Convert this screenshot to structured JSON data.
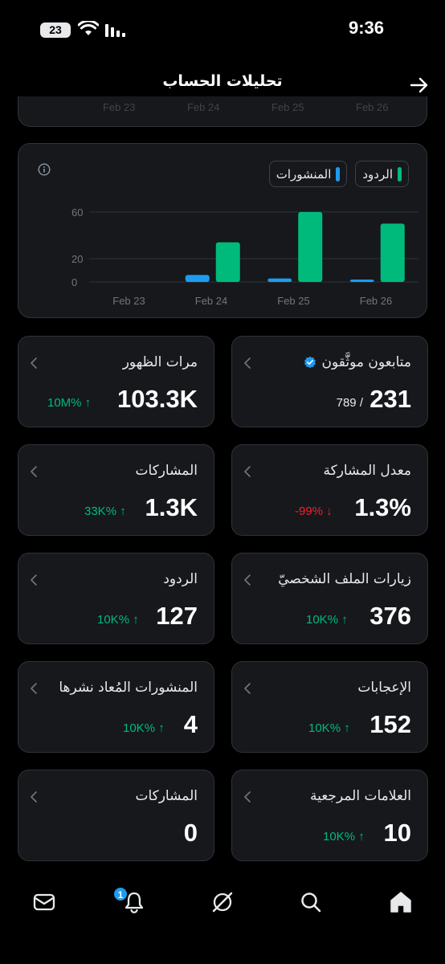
{
  "status": {
    "time": "9:36",
    "battery": "23"
  },
  "header": {
    "title": "تحليلات الحساب"
  },
  "remnant_ticks": [
    "Feb 23",
    "Feb 24",
    "Feb 25",
    "Feb 26"
  ],
  "legend": {
    "posts": "المنشورات",
    "replies": "الردود"
  },
  "colors": {
    "posts": "#1d9bf0",
    "replies": "#00ba7c",
    "background": "#000000",
    "card": "#16181c",
    "border": "#2f3336",
    "up": "#00ba7c",
    "down": "#f4212e"
  },
  "chart_data": {
    "type": "bar",
    "categories": [
      "Feb 23",
      "Feb 24",
      "Feb 25",
      "Feb 26"
    ],
    "series": [
      {
        "name": "المنشورات",
        "values": [
          0,
          6,
          3,
          2
        ]
      },
      {
        "name": "الردود",
        "values": [
          0,
          34,
          60,
          50
        ]
      }
    ],
    "yticks": [
      0,
      20,
      60
    ],
    "ylim": [
      0,
      62
    ],
    "grid": true,
    "legend_position": "top-right"
  },
  "stats": {
    "verified_followers": {
      "label": "متابعون موثَّقون",
      "value": "231",
      "sub": "789 /"
    },
    "impressions": {
      "label": "مرات الظهور",
      "value": "103.3K",
      "delta": "10M% ↑"
    },
    "engagement_rate": {
      "label": "معدل المشاركة",
      "value": "1.3%",
      "delta": "-99% ↓"
    },
    "engagements": {
      "label": "المشاركات",
      "value": "1.3K",
      "delta": "33K% ↑"
    },
    "profile_visits": {
      "label": "زيارات الملف الشخصيّ",
      "value": "376",
      "delta": "10K% ↑"
    },
    "replies": {
      "label": "الردود",
      "value": "127",
      "delta": "10K% ↑"
    },
    "likes": {
      "label": "الإعجابات",
      "value": "152",
      "delta": "10K% ↑"
    },
    "reposts": {
      "label": "المنشورات المُعاد نشرها",
      "value": "4",
      "delta": "10K% ↑"
    },
    "bookmarks": {
      "label": "العلامات المرجعية",
      "value": "10",
      "delta": "10K% ↑"
    },
    "shares": {
      "label": "المشاركات",
      "value": "0"
    }
  },
  "nav": {
    "notification_count": "1",
    "icons": [
      "home-icon",
      "search-icon",
      "grok-icon",
      "notifications-icon",
      "messages-icon"
    ]
  }
}
